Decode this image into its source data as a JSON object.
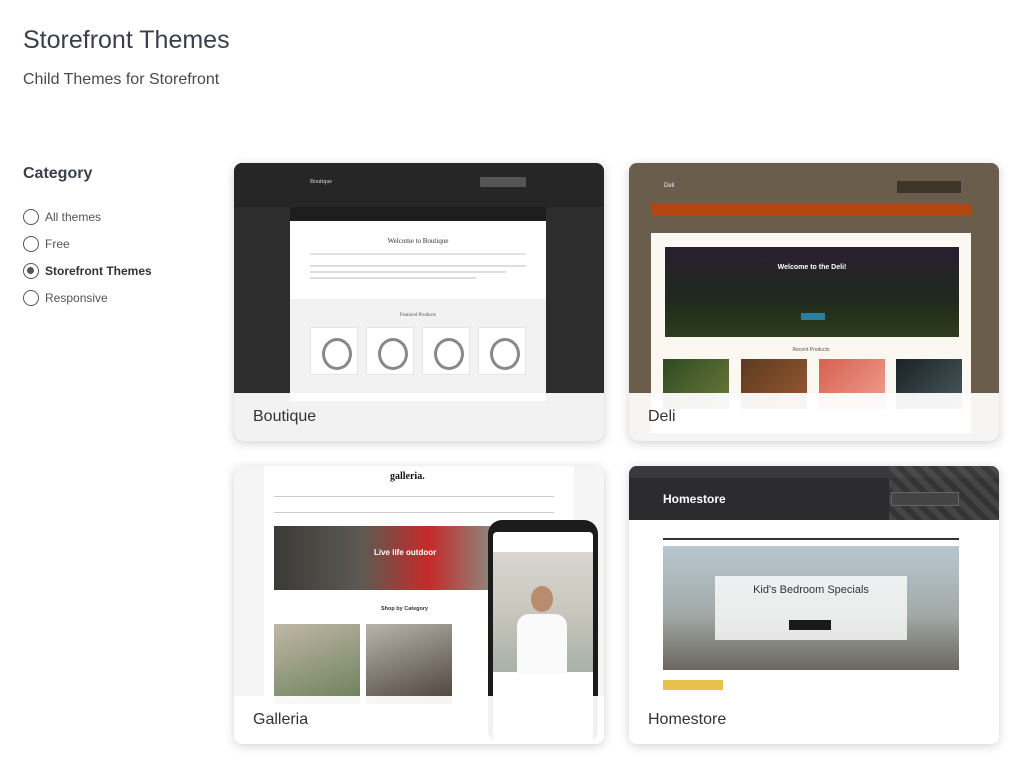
{
  "header": {
    "title": "Storefront Themes",
    "subtitle": "Child Themes for Storefront"
  },
  "sidebar": {
    "heading": "Category",
    "options": [
      {
        "label": "All themes",
        "checked": false
      },
      {
        "label": "Free",
        "checked": false
      },
      {
        "label": "Storefront Themes",
        "checked": true
      },
      {
        "label": "Responsive",
        "checked": false
      }
    ]
  },
  "themes": [
    {
      "name": "Boutique",
      "preview": {
        "site_title": "Boutique",
        "welcome_heading": "Welcome to Boutique",
        "featured_heading": "Featured Products"
      }
    },
    {
      "name": "Deli",
      "preview": {
        "site_title": "Deli",
        "welcome_heading": "Welcome to the Deli!",
        "recent_heading": "Recent Products"
      }
    },
    {
      "name": "Galleria",
      "preview": {
        "site_title": "galleria.",
        "hero_text": "Live life outdoor",
        "section_heading": "Shop by Category"
      }
    },
    {
      "name": "Homestore",
      "preview": {
        "site_title": "Homestore",
        "hero_heading": "Kid's Bedroom Specials"
      }
    }
  ],
  "colors": {
    "deli_nav": "#b3470f",
    "homestore_tag": "#e6c24a",
    "galleria_hero_accent": "#c52a2a"
  }
}
